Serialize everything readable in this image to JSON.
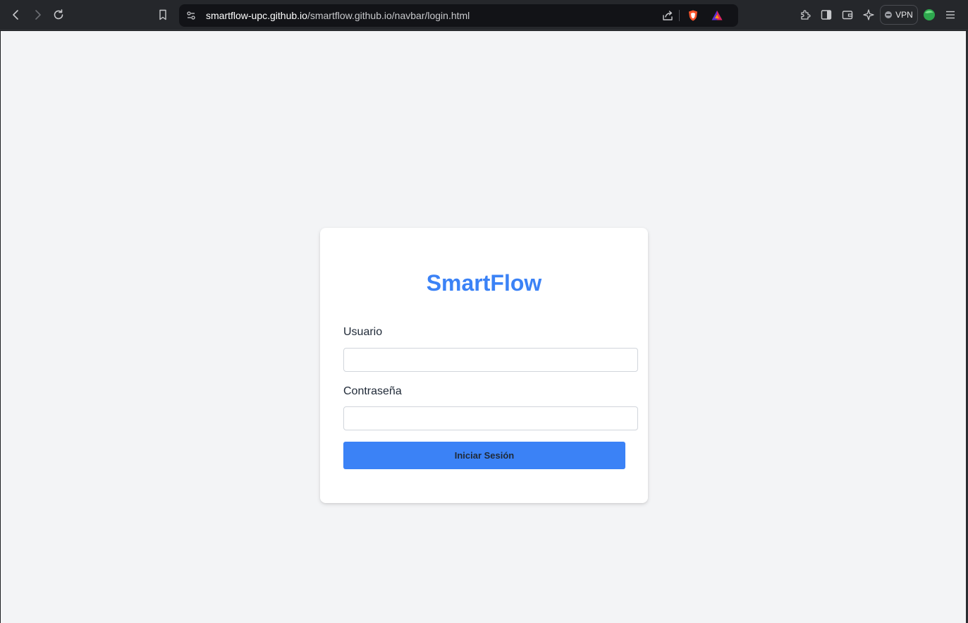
{
  "browser": {
    "url_host": "smartflow-upc.github.io",
    "url_path": "/smartflow.github.io/navbar/login.html",
    "vpn_label": "VPN"
  },
  "login": {
    "brand": "SmartFlow",
    "username_label": "Usuario",
    "username_value": "",
    "password_label": "Contraseña",
    "password_value": "",
    "submit_label": "Iniciar Sesión"
  },
  "colors": {
    "accent": "#3b82f6",
    "page_bg": "#f3f4f6",
    "chrome_bg": "#25272b"
  },
  "icons": [
    "back-icon",
    "forward-icon",
    "reload-icon",
    "bookmark-icon",
    "site-settings-icon",
    "share-icon",
    "brave-shields-icon",
    "brave-rewards-icon",
    "extensions-icon",
    "sidebar-icon",
    "wallet-icon",
    "leo-ai-icon",
    "profile-icon",
    "menu-icon"
  ]
}
